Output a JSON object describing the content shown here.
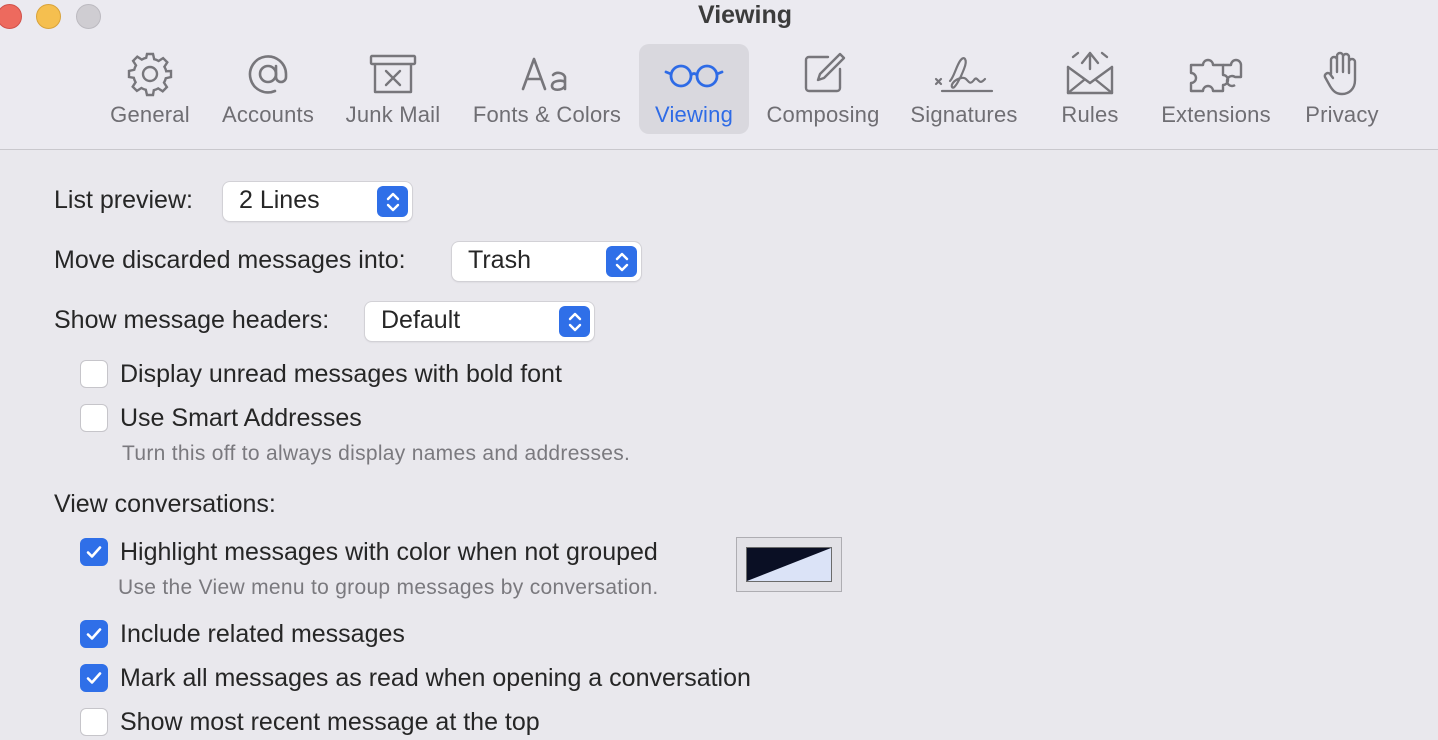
{
  "window": {
    "title": "Viewing"
  },
  "toolbar": {
    "tabs": [
      {
        "label": "General",
        "icon": "gear-icon"
      },
      {
        "label": "Accounts",
        "icon": "at-sign-icon"
      },
      {
        "label": "Junk Mail",
        "icon": "junk-mail-icon"
      },
      {
        "label": "Fonts & Colors",
        "icon": "fonts-icon"
      },
      {
        "label": "Viewing",
        "icon": "glasses-icon",
        "active": true
      },
      {
        "label": "Composing",
        "icon": "compose-icon"
      },
      {
        "label": "Signatures",
        "icon": "signature-icon"
      },
      {
        "label": "Rules",
        "icon": "rules-envelope-icon"
      },
      {
        "label": "Extensions",
        "icon": "puzzle-piece-icon"
      },
      {
        "label": "Privacy",
        "icon": "hand-icon"
      }
    ]
  },
  "settings": {
    "list_preview": {
      "label": "List preview:",
      "value": "2 Lines"
    },
    "discarded": {
      "label": "Move discarded messages into:",
      "value": "Trash"
    },
    "headers": {
      "label": "Show message headers:",
      "value": "Default"
    },
    "bold_unread": {
      "label": "Display unread messages with bold font",
      "checked": false
    },
    "smart_addresses": {
      "label": "Use Smart Addresses",
      "checked": false,
      "hint": "Turn this off to always display names and addresses."
    },
    "view_conversations_heading": "View conversations:",
    "highlight": {
      "label": "Highlight messages with color when not grouped",
      "checked": true,
      "hint": "Use the View menu to group messages by conversation."
    },
    "related": {
      "label": "Include related messages",
      "checked": true
    },
    "mark_read": {
      "label": "Mark all messages as read when opening a conversation",
      "checked": true
    },
    "recent_top": {
      "label": "Show most recent message at the top",
      "checked": false
    }
  },
  "colors": {
    "accent": "#2f6fe8",
    "highlight_swatch_dark": "#0a0f24",
    "highlight_swatch_light": "#dbe3f7"
  }
}
